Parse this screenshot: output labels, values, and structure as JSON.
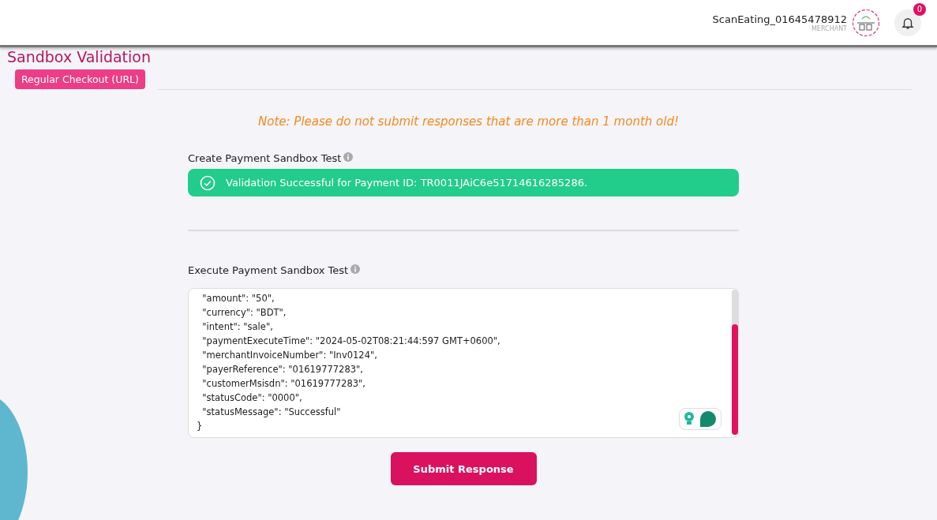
{
  "header": {
    "account_name": "ScanEating_01645478912",
    "account_role": "MERCHANT",
    "notification_count": "0"
  },
  "page": {
    "title": "Sandbox Validation",
    "tabs": [
      {
        "label": "Regular Checkout (URL)",
        "selected": true
      }
    ]
  },
  "note": "Note: Please do not submit responses that are more than 1 month old!",
  "create_test": {
    "label": "Create Payment Sandbox Test",
    "status": {
      "kind": "success",
      "message": "Validation Successful for Payment ID: TR0011JAiC6e51714616285286."
    }
  },
  "execute_test": {
    "label": "Execute Payment Sandbox Test",
    "response_lines": [
      "  \"amount\": \"50\",",
      "  \"currency\": \"BDT\",",
      "  \"intent\": \"sale\",",
      "  \"paymentExecuteTime\": \"2024-05-02T08:21:44:597 GMT+0600\",",
      "  \"merchantInvoiceNumber\": \"Inv0124\",",
      "  \"payerReference\": \"01619777283\",",
      "  \"customerMsisdn\": \"01619777283\",",
      "  \"statusCode\": \"0000\",",
      "  \"statusMessage\": \"Successful\"",
      "}"
    ]
  },
  "submit_button": "Submit Response"
}
